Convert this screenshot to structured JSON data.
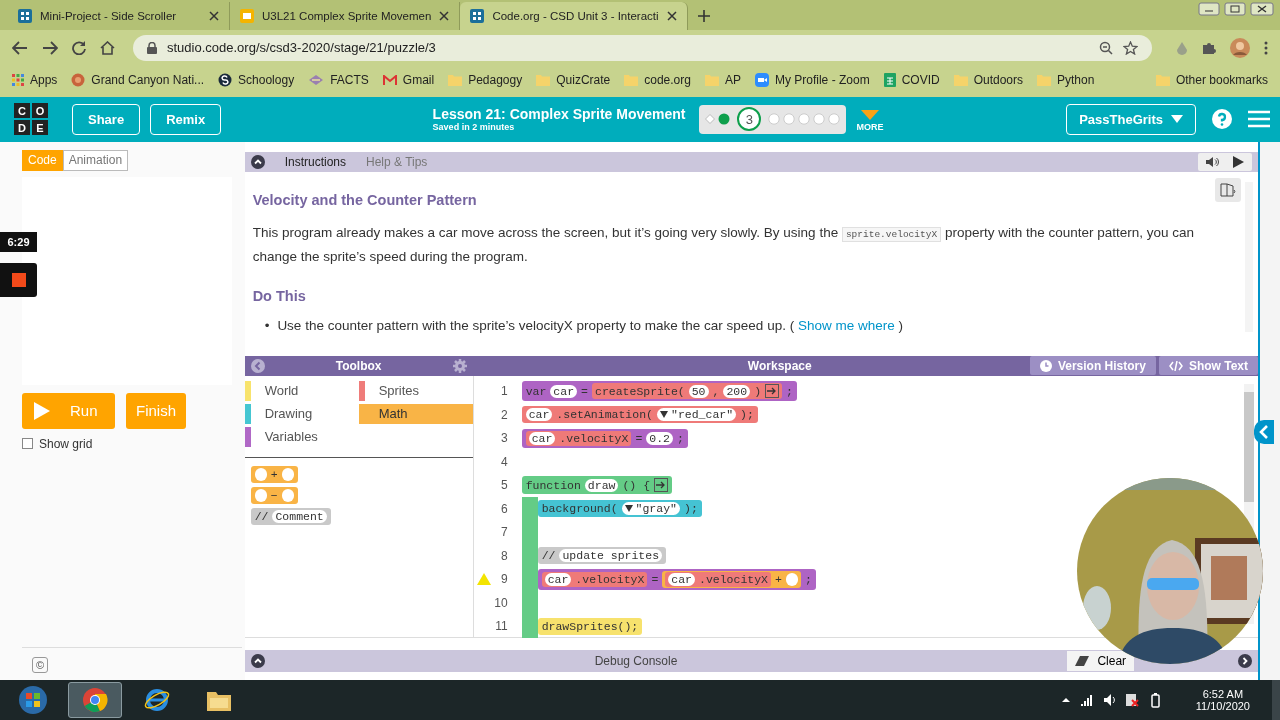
{
  "browser": {
    "tabs": [
      {
        "title": "Mini-Project - Side Scroller",
        "kind": "codeorg",
        "selected": false
      },
      {
        "title": "U3L21 Complex Sprite Movemen",
        "kind": "slides",
        "selected": false
      },
      {
        "title": "Code.org - CSD Unit 3 - Interacti",
        "kind": "codeorg",
        "selected": true
      }
    ],
    "url": "studio.code.org/s/csd3-2020/stage/21/puzzle/3",
    "bookmarks": [
      {
        "label": "Apps",
        "kind": "apps"
      },
      {
        "label": "Grand Canyon Nati...",
        "kind": "site"
      },
      {
        "label": "Schoology",
        "kind": "schoology"
      },
      {
        "label": "FACTS",
        "kind": "facts"
      },
      {
        "label": "Gmail",
        "kind": "gmail"
      },
      {
        "label": "Pedagogy",
        "kind": "folder"
      },
      {
        "label": "QuizCrate",
        "kind": "folder"
      },
      {
        "label": "code.org",
        "kind": "folder"
      },
      {
        "label": "AP",
        "kind": "folder"
      },
      {
        "label": "My Profile - Zoom",
        "kind": "zoom"
      },
      {
        "label": "COVID",
        "kind": "sheets"
      },
      {
        "label": "Outdoors",
        "kind": "folder"
      },
      {
        "label": "Python",
        "kind": "folder"
      },
      {
        "label": "Other bookmarks",
        "kind": "folder"
      }
    ]
  },
  "header": {
    "logo": [
      "C",
      "O",
      "D",
      "E"
    ],
    "buttons": [
      "Share",
      "Remix"
    ],
    "lesson_title": "Lesson 21: Complex Sprite Movement",
    "save_status": "Saved in 2 minutes",
    "progress": [
      {
        "kind": "diamond"
      },
      {
        "kind": "done"
      },
      {
        "kind": "current",
        "label": "3"
      },
      {
        "kind": "todo"
      },
      {
        "kind": "todo"
      },
      {
        "kind": "todo"
      },
      {
        "kind": "todo"
      },
      {
        "kind": "todo"
      }
    ],
    "more": "MORE",
    "user": "PassTheGrits"
  },
  "left_panel": {
    "mode_tabs": [
      {
        "label": "Code",
        "selected": true
      },
      {
        "label": "Animation",
        "selected": false
      }
    ],
    "recorder_time": "6:29",
    "run": "Run",
    "finish": "Finish",
    "show_grid": {
      "label": "Show grid",
      "checked": false
    },
    "footer_icon": "©"
  },
  "instructions": {
    "tabs": [
      {
        "label": "Instructions",
        "selected": true
      },
      {
        "label": "Help & Tips",
        "selected": false
      }
    ],
    "title": "Velocity and the Counter Pattern",
    "paragraph": {
      "before": "This program already makes a car move across the screen, but it’s going very slowly. By using the",
      "code": "sprite.velocityX",
      "after": "property with the counter pattern, you can change the sprite’s speed during the program."
    },
    "subtitle": "Do This",
    "bullets": [
      {
        "marker": "•",
        "text": "Use the counter pattern with the sprite’s velocityX property to make the car speed up. (",
        "link": "Show me where",
        "after": ")"
      }
    ]
  },
  "toolbox": {
    "title": "Toolbox",
    "categories": [
      {
        "label": "World",
        "color": "#f8e36c",
        "selected": false
      },
      {
        "label": "Sprites",
        "color": "#ef7c7a",
        "selected": false
      },
      {
        "label": "Drawing",
        "color": "#45c6d2",
        "selected": false
      },
      {
        "label": "Math",
        "color": "#f9b446",
        "selected": true
      },
      {
        "label": "Variables",
        "color": "#b068c6",
        "selected": false
      }
    ],
    "blocks": [
      {
        "kind": "math",
        "op": "+"
      },
      {
        "kind": "math",
        "op": "−"
      },
      {
        "kind": "comment",
        "prefix": "//",
        "label": "Comment"
      }
    ]
  },
  "workspace": {
    "title": "Workspace",
    "buttons": [
      {
        "label": "Version History",
        "kind": "clock"
      },
      {
        "label": "Show Text",
        "kind": "code"
      }
    ],
    "lines": [
      {
        "number": "1",
        "kind": "variables",
        "warning": false,
        "parts": [
          {
            "kind": "text",
            "text": "var"
          },
          {
            "kind": "slot",
            "text": "car"
          },
          {
            "kind": "text",
            "text": "="
          },
          {
            "kind": "sprites",
            "parts": [
              {
                "kind": "text",
                "text": "createSprite("
              },
              {
                "kind": "slot",
                "text": "50"
              },
              {
                "kind": "text",
                "text": ","
              },
              {
                "kind": "slot",
                "text": "200"
              },
              {
                "kind": "text",
                "text": ")"
              },
              {
                "kind": "arrow"
              }
            ]
          },
          {
            "kind": "text",
            "text": ";"
          }
        ]
      },
      {
        "number": "2",
        "kind": "sprites",
        "warning": false,
        "parts": [
          {
            "kind": "slot",
            "text": "car"
          },
          {
            "kind": "text",
            "text": ".setAnimation("
          },
          {
            "kind": "dropdown",
            "text": "\"red_car\""
          },
          {
            "kind": "text",
            "text": ");"
          }
        ]
      },
      {
        "number": "3",
        "kind": "variables",
        "warning": false,
        "parts": [
          {
            "kind": "sprites",
            "parts": [
              {
                "kind": "slot",
                "text": "car"
              },
              {
                "kind": "text",
                "text": ".velocityX"
              }
            ]
          },
          {
            "kind": "text",
            "text": "="
          },
          {
            "kind": "slot",
            "text": "0.2"
          },
          {
            "kind": "text",
            "text": ";"
          }
        ]
      },
      {
        "number": "4",
        "warning": false
      },
      {
        "number": "5",
        "kind": "function",
        "warning": false,
        "parts": [
          {
            "kind": "text",
            "text": "function"
          },
          {
            "kind": "slot",
            "text": "draw"
          },
          {
            "kind": "text",
            "text": "() {"
          },
          {
            "kind": "arrow"
          }
        ],
        "children": [
          {
            "number": "6",
            "kind": "drawing",
            "warning": false,
            "parts": [
              {
                "kind": "text",
                "text": "background("
              },
              {
                "kind": "dropdown",
                "text": "\"gray\""
              },
              {
                "kind": "text",
                "text": ");"
              }
            ]
          },
          {
            "number": "7",
            "warning": false
          },
          {
            "number": "8",
            "kind": "comment",
            "warning": false,
            "parts": [
              {
                "kind": "text",
                "text": "//"
              },
              {
                "kind": "slot",
                "text": "update sprites"
              }
            ]
          },
          {
            "number": "9",
            "kind": "variables",
            "warning": true,
            "parts": [
              {
                "kind": "sprites",
                "parts": [
                  {
                    "kind": "slot",
                    "text": "car"
                  },
                  {
                    "kind": "text",
                    "text": ".velocityX"
                  }
                ]
              },
              {
                "kind": "text",
                "text": "="
              },
              {
                "kind": "math",
                "parts": [
                  {
                    "kind": "sprites",
                    "parts": [
                      {
                        "kind": "slot",
                        "text": "car"
                      },
                      {
                        "kind": "text",
                        "text": ".velocityX"
                      }
                    ]
                  },
                  {
                    "kind": "text",
                    "text": "+"
                  },
                  {
                    "kind": "empty-slot"
                  }
                ]
              },
              {
                "kind": "text",
                "text": ";"
              }
            ]
          },
          {
            "number": "10",
            "warning": false
          },
          {
            "number": "11",
            "kind": "world",
            "warning": false,
            "parts": [
              {
                "kind": "text",
                "text": "drawSprites();"
              }
            ]
          }
        ]
      }
    ]
  },
  "debug": {
    "title": "Debug Console",
    "clear": "Clear"
  },
  "taskbar": {
    "apps": [
      {
        "kind": "start",
        "selected": false
      },
      {
        "kind": "chrome",
        "selected": true
      },
      {
        "kind": "ie",
        "selected": false
      },
      {
        "kind": "explorer",
        "selected": false
      }
    ],
    "time": "6:52 AM",
    "date": "11/10/2020"
  }
}
